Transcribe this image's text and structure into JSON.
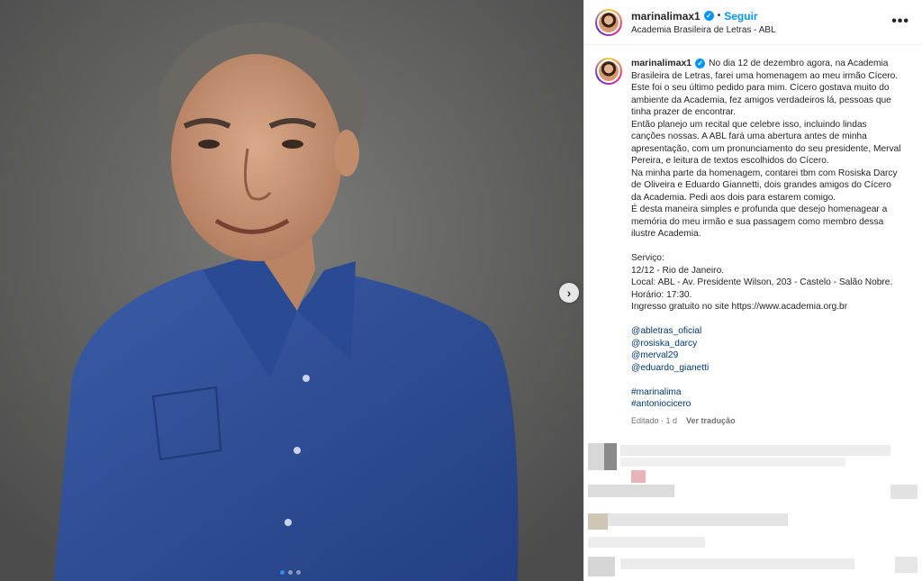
{
  "post": {
    "username": "marinalimax1",
    "follow_label": "Seguir",
    "location": "Academia Brasileira de Letras - ABL",
    "more_label": "•••",
    "next_label": "›"
  },
  "caption": {
    "username": "marinalimax1",
    "paragraphs": [
      "No dia 12 de dezembro agora, na Academia Brasileira de Letras, farei uma homenagem ao meu irmão Cícero.",
      "Este foi o seu último pedido para mim. Cícero gostava muito do ambiente da Academia, fez amigos verdadeiros lá, pessoas que tinha prazer de encontrar.",
      "Então planejo um recital que celebre isso, incluindo lindas canções nossas. A ABL fará uma abertura antes de minha apresentação, com um pronunciamento do seu presidente, Merval Pereira, e leitura de textos escolhidos do Cícero.",
      "Na minha parte da homenagem, contarei tbm com Rosiska Darcy de Oliveira e Eduardo Giannetti, dois grandes amigos do Cícero da Academia. Pedi aos dois para estarem comigo.",
      "É desta maneira simples e profunda que desejo homenagear a memória do meu irmão e sua passagem como membro dessa ilustre Academia."
    ],
    "service": [
      "Serviço:",
      "12/12 - Rio de Janeiro.",
      "Local: ABL - Av. Presidente Wilson, 203 - Castelo - Salão Nobre.",
      "Horário: 17:30.",
      "Ingresso gratuito no site https://www.academia.org.br"
    ],
    "mentions": [
      "@abletras_oficial",
      "@rosiska_darcy",
      "@merval29",
      "@eduardo_gianetti"
    ],
    "hashtags": [
      "#marinalima",
      "#antoniocicero"
    ],
    "edited": "Editado · 1 d",
    "translate_label": "Ver tradução"
  },
  "carousel": {
    "count": 3,
    "active": 0
  },
  "colors": {
    "link": "#00376b",
    "accent": "#0095f6",
    "shirt": "#2e4f9a"
  }
}
